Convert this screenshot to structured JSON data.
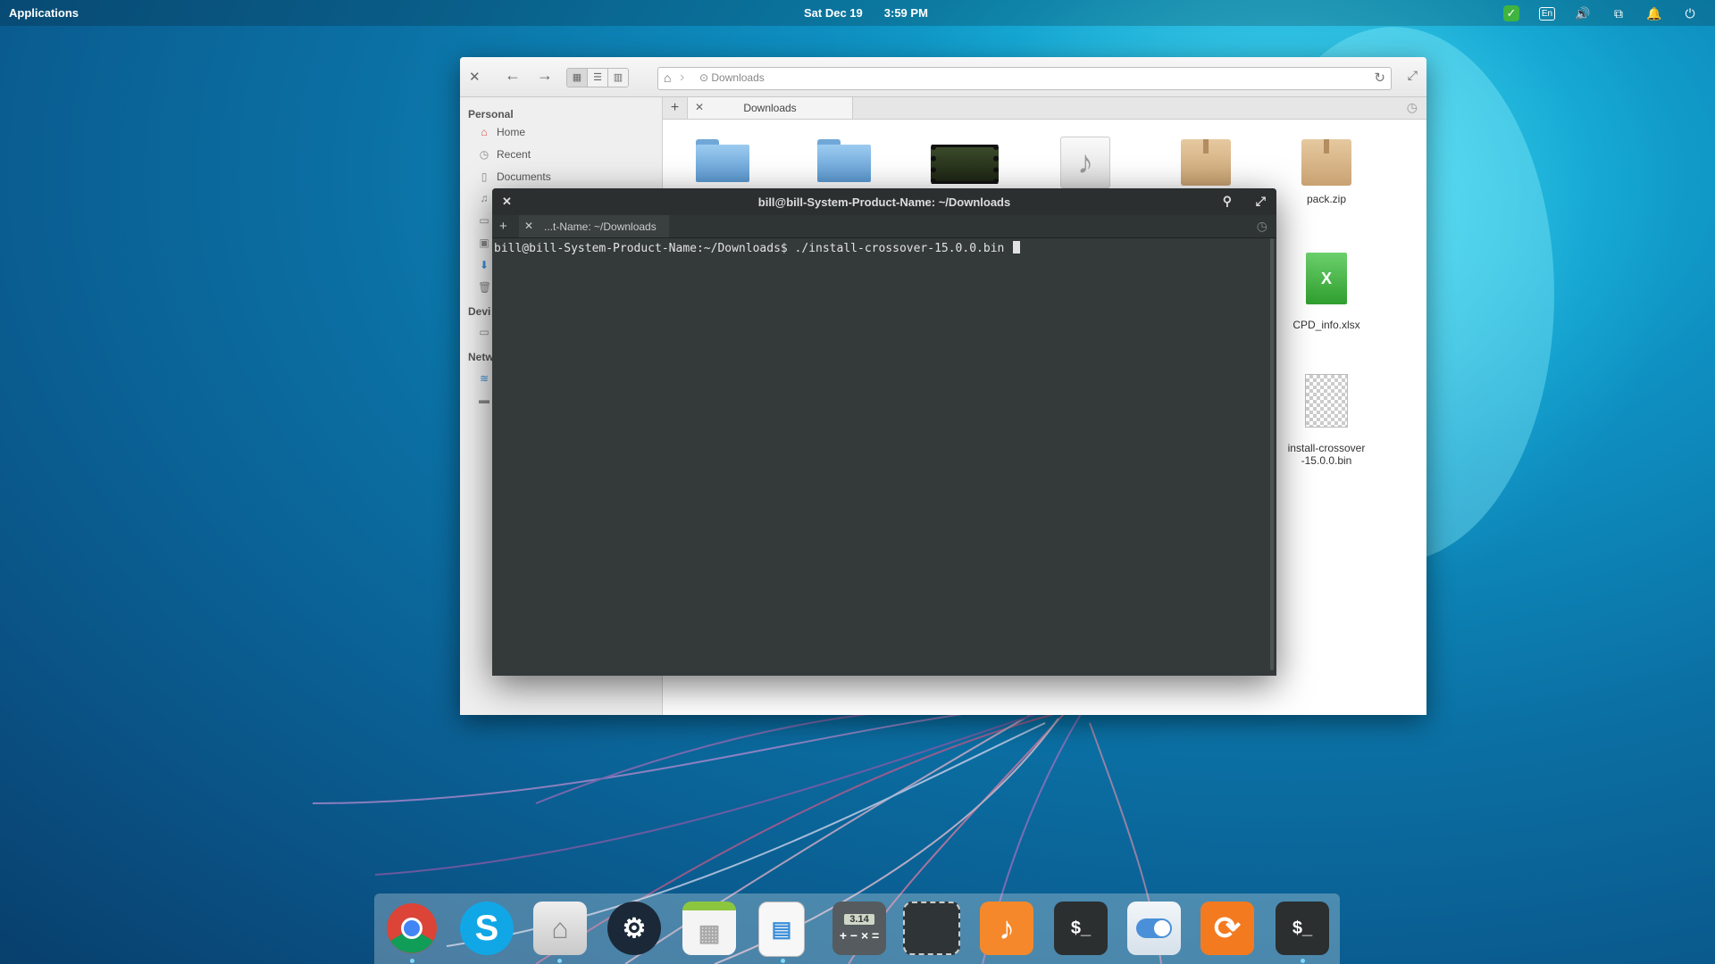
{
  "panel": {
    "applications": "Applications",
    "date": "Sat Dec 19",
    "time": "3:59 PM",
    "indicators": [
      "check-icon",
      "keyboard-layout-icon",
      "volume-icon",
      "network-icon",
      "notifications-icon",
      "power-icon"
    ],
    "keyboard_layout": "En"
  },
  "file_manager": {
    "path_segment": "Downloads",
    "tab_label": "Downloads",
    "sidebar": {
      "personal_heading": "Personal",
      "items": [
        "Home",
        "Recent",
        "Documents"
      ],
      "devices_heading": "Devi",
      "network_heading": "Netw"
    },
    "files": [
      {
        "name": "",
        "type": "folder"
      },
      {
        "name": "",
        "type": "folder"
      },
      {
        "name": "",
        "type": "video"
      },
      {
        "name": "",
        "type": "audio"
      },
      {
        "name": "",
        "type": "package"
      },
      {
        "name": "pack.zip",
        "type": "package"
      },
      {
        "name": "CPD_info.xlsx",
        "type": "spreadsheet"
      },
      {
        "name": "install-crossover-15.0.0.bin",
        "type": "binary"
      }
    ]
  },
  "terminal": {
    "title": "bill@bill-System-Product-Name: ~/Downloads",
    "tab_label": "...t-Name: ~/Downloads",
    "prompt": "bill@bill-System-Product-Name:~/Downloads$ ./install-crossover-15.0.0.bin "
  },
  "dock": {
    "apps": [
      {
        "name": "chrome",
        "color": "#e8e8e8"
      },
      {
        "name": "skype",
        "color": "#11a7e6"
      },
      {
        "name": "files",
        "color": "#dcdcdc"
      },
      {
        "name": "steam",
        "color": "#1b2838"
      },
      {
        "name": "calendar",
        "color": "#f4f4f4"
      },
      {
        "name": "document-viewer",
        "color": "#f7f7f7"
      },
      {
        "name": "calculator",
        "color": "#555b5e"
      },
      {
        "name": "screenshot",
        "color": "#2f3436"
      },
      {
        "name": "music",
        "color": "#f4882b"
      },
      {
        "name": "terminal",
        "color": "#2b2f30"
      },
      {
        "name": "switchboard",
        "color": "#e6eef4"
      },
      {
        "name": "software-update",
        "color": "#f47a20"
      },
      {
        "name": "terminal",
        "color": "#2b2f30"
      }
    ],
    "calculator_display": "3.14",
    "terminal_glyph": "$_"
  }
}
